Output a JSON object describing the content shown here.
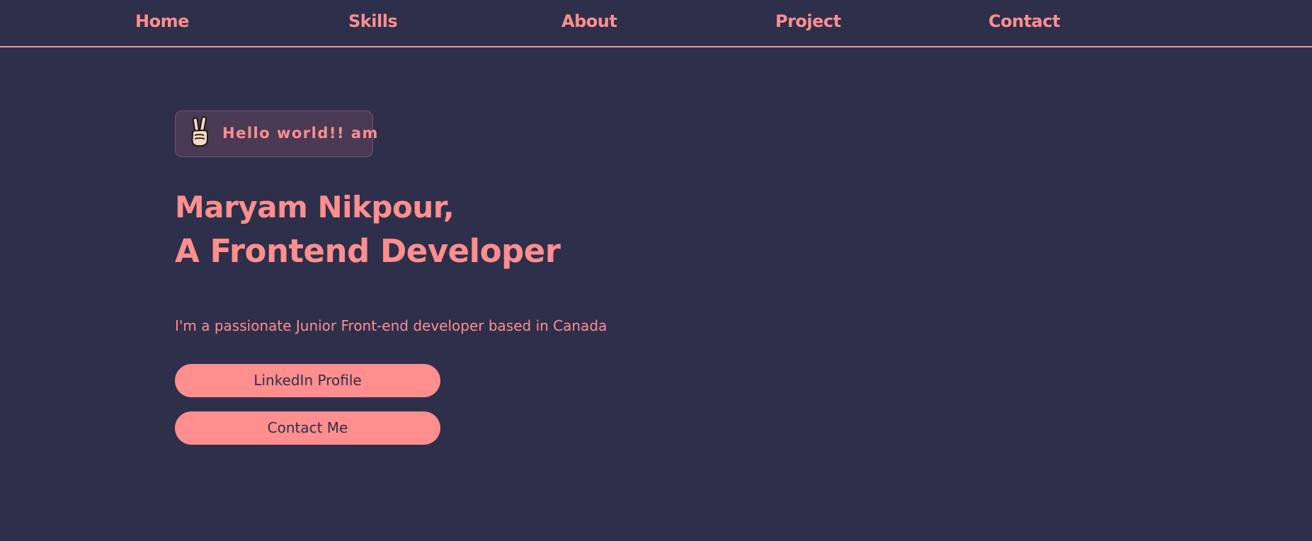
{
  "nav": {
    "home": "Home",
    "skills": "Skills",
    "about": "About",
    "project": "Project",
    "contact": "Contact"
  },
  "hero": {
    "greeting_icon": "victory-hand-icon",
    "greeting": "Hello world!! am",
    "title_line1": "Maryam Nikpour,",
    "title_line2": "A Frontend Developer",
    "subtitle": "I'm a passionate Junior Front-end developer based in Canada",
    "linkedin_button": "LinkedIn Profile",
    "contact_button": "Contact Me"
  },
  "colors": {
    "background": "#2e2f4b",
    "accent": "#ff8e8e",
    "badge_background": "#4a3a56"
  }
}
